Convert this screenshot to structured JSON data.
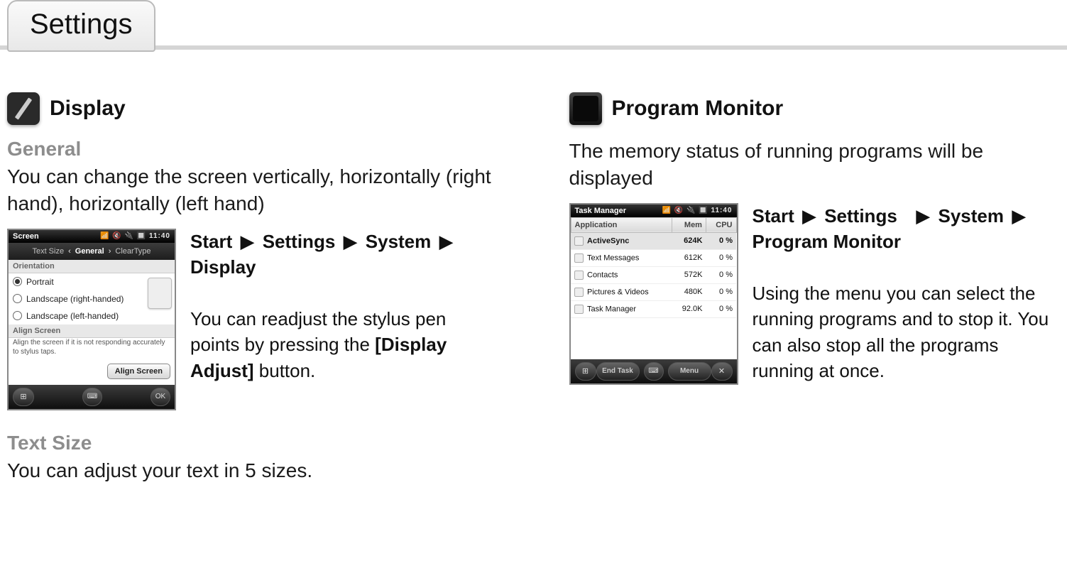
{
  "header": {
    "title": "Settings"
  },
  "display": {
    "section_title": "Display",
    "general_label": "General",
    "general_desc": "You can change the screen vertically, horizontally (right hand), horizontally (left hand)",
    "path": {
      "p1": "Start",
      "p2": "Settings",
      "p3": "System",
      "p4": "Display"
    },
    "adjust_text_pre": "You can readjust the stylus pen points by pressing the ",
    "adjust_text_bold": "[Display Adjust]",
    "adjust_text_post": " button.",
    "textsize_label": "Text Size",
    "textsize_desc": "You can adjust your text in 5 sizes.",
    "mini": {
      "title": "Screen",
      "status_right": "📶 🔇 🔌 🔲 11:40",
      "tab_left": "Text Size",
      "tab_center": "General",
      "tab_right": "ClearType",
      "group1": "Orientation",
      "opt1": "Portrait",
      "opt2": "Landscape (right-handed)",
      "opt3": "Landscape (left-handed)",
      "group2": "Align Screen",
      "note": "Align the screen if it is not responding accurately to stylus taps.",
      "align_btn": "Align Screen",
      "ok": "OK"
    }
  },
  "monitor": {
    "section_title": "Program Monitor",
    "intro": "The memory status of running programs will be displayed",
    "path": {
      "p1": "Start",
      "p2": "Settings",
      "p3": "System",
      "p4": "Program Monitor"
    },
    "desc": "Using the menu you can select the running programs and to stop it. You can also stop all the programs running at once.",
    "mini": {
      "title": "Task Manager",
      "status_right": "📶 🔇 🔌 🔲 11:40",
      "col_app": "Application",
      "col_mem": "Mem",
      "col_cpu": "CPU",
      "rows": [
        {
          "name": "ActiveSync",
          "mem": "624K",
          "cpu": "0 %",
          "hl": true
        },
        {
          "name": "Text Messages",
          "mem": "612K",
          "cpu": "0 %",
          "hl": false
        },
        {
          "name": "Contacts",
          "mem": "572K",
          "cpu": "0 %",
          "hl": false
        },
        {
          "name": "Pictures & Videos",
          "mem": "480K",
          "cpu": "0 %",
          "hl": false
        },
        {
          "name": "Task Manager",
          "mem": "92.0K",
          "cpu": "0 %",
          "hl": false
        }
      ],
      "soft_left": "End Task",
      "soft_right": "Menu"
    }
  },
  "arrow": "▶"
}
